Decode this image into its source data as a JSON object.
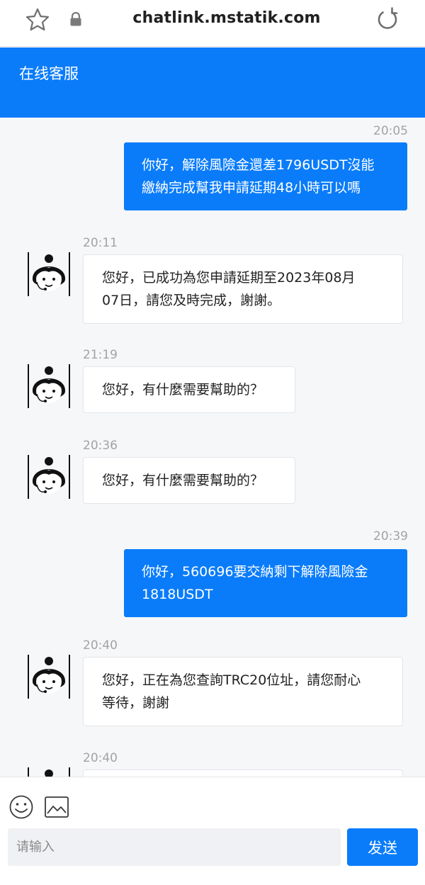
{
  "browser": {
    "url": "chatlink.mstatik.com",
    "icons": [
      "star-icon",
      "lock-icon",
      "reload-icon"
    ]
  },
  "header": {
    "title": "在线客服",
    "color": "#0a7cfa"
  },
  "messages": [
    {
      "direction": "out",
      "time": "20:05",
      "lines": [
        "你好，解除風險金還差1796USDT沒能",
        "繳納完成幫我申請延期48小時可以嗎"
      ]
    },
    {
      "direction": "in",
      "time": "20:11",
      "lines": [
        "您好，已成功為您申請延期至2023年08月",
        "07日，請您及時完成，謝謝。"
      ]
    },
    {
      "direction": "in",
      "time": "21:19",
      "lines": [
        "您好，有什麼需要幫助的？"
      ]
    },
    {
      "direction": "in",
      "time": "20:36",
      "lines": [
        "您好，有什麼需要幫助的？"
      ]
    },
    {
      "direction": "out",
      "time": "20:39",
      "lines": [
        "你好，560696要交納剩下解除風險金",
        "1818USDT"
      ]
    },
    {
      "direction": "in",
      "time": "20:40",
      "lines": [
        "您好，正在為您查詢TRC20位址，請您耐心",
        "等待，謝謝"
      ]
    },
    {
      "direction": "in",
      "time": "20:40",
      "lines": []
    }
  ],
  "input": {
    "placeholder": "请输入",
    "value": ""
  },
  "send_label": "发送",
  "toolbar_icons": [
    "emoji-icon",
    "image-icon"
  ],
  "colors": {
    "accent": "#0a7cfa",
    "chat_bg": "#f6f7f9",
    "timestamp": "#a3a3a3"
  }
}
